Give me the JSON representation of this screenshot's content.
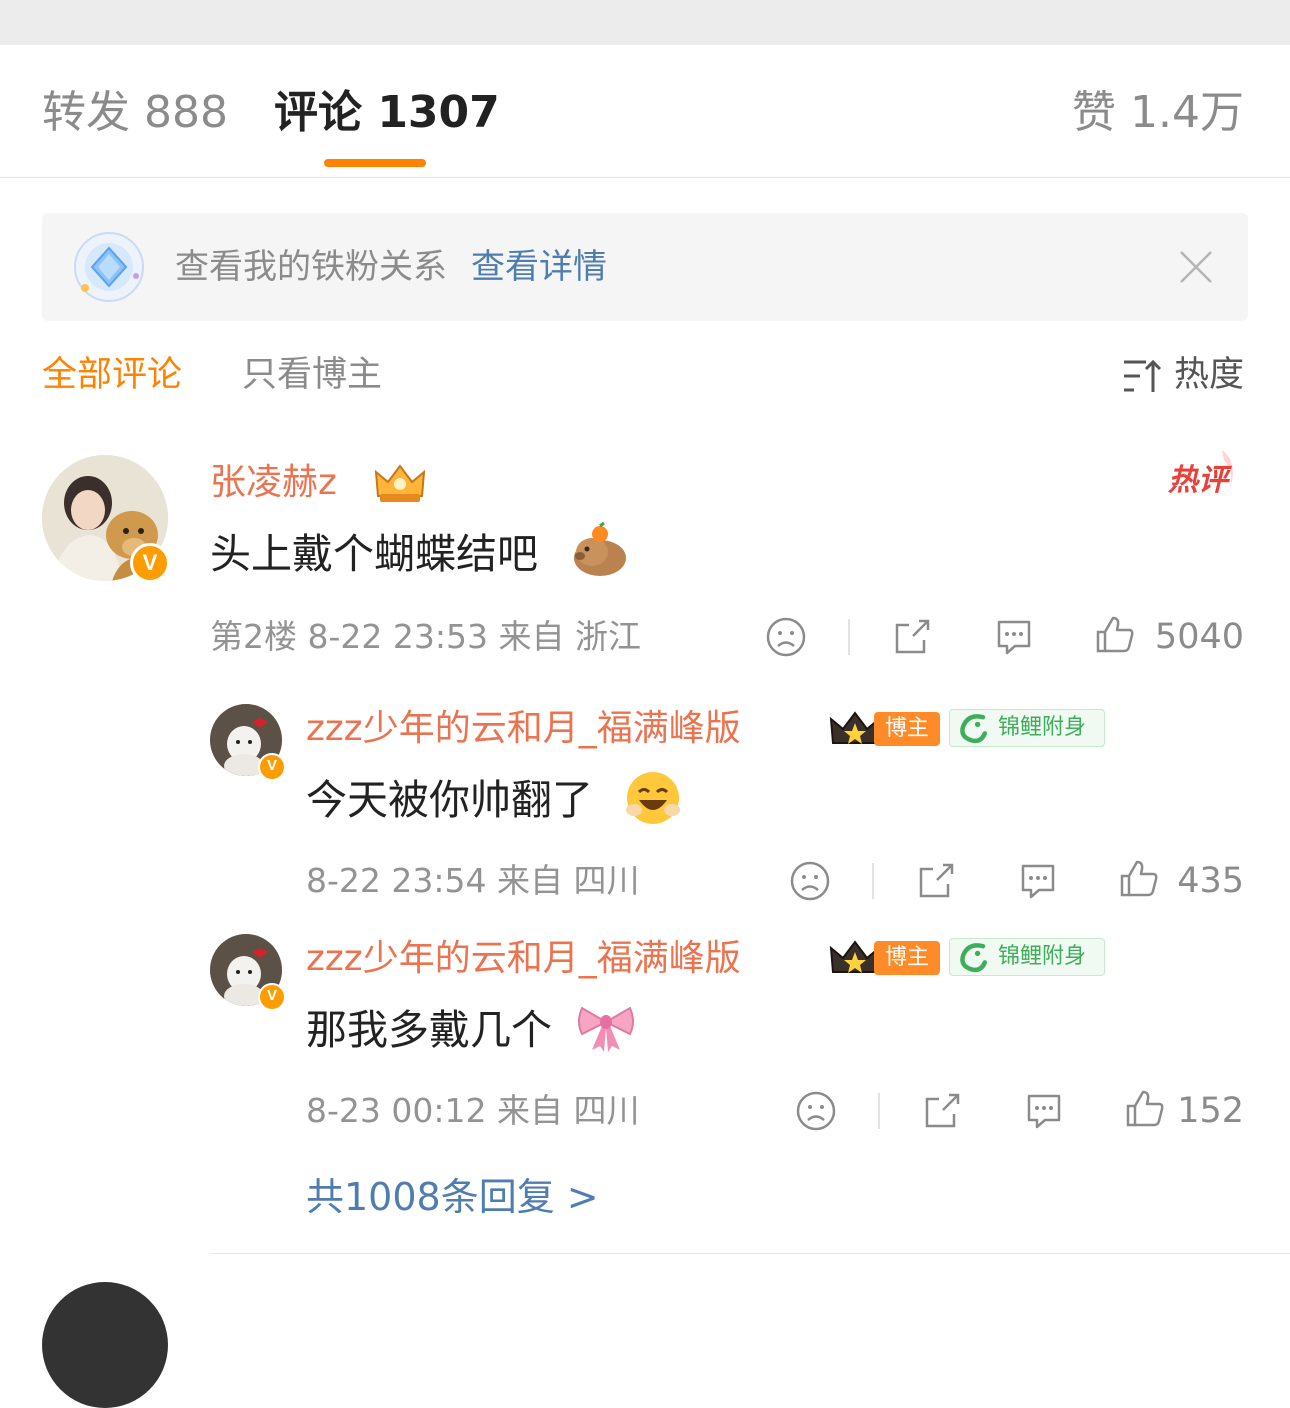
{
  "tabs": {
    "repost": "转发 888",
    "comments": "评论 1307",
    "likes": "赞 1.4万"
  },
  "fan_banner": {
    "text": "查看我的铁粉关系",
    "link": "查看详情",
    "icon": "diamond-icon",
    "close_icon": "close-icon"
  },
  "filters": {
    "all": "全部评论",
    "owner_only": "只看博主",
    "sort_label": "热度",
    "sort_icon": "sort-icon"
  },
  "colors": {
    "accent": "#ff8200",
    "username": "#eb7350",
    "link": "#507daf"
  },
  "main_comment": {
    "username": "张凌赫z",
    "text": "头上戴个蝴蝶结吧",
    "emoji": "capybara-emoji",
    "hot_badge": "热评",
    "meta": "第2楼 8-22 23:53 来自 浙江",
    "likes": "5040"
  },
  "replies": [
    {
      "username": "zzz少年的云和月_福满峰版",
      "owner_badge": "博主",
      "koi_badge": "锦鲤附身",
      "text": "今天被你帅翻了",
      "emoji": "smile-emoji",
      "meta": "8-22 23:54 来自 四川",
      "likes": "435"
    },
    {
      "username": "zzz少年的云和月_福满峰版",
      "owner_badge": "博主",
      "koi_badge": "锦鲤附身",
      "text": "那我多戴几个",
      "emoji": "bow-emoji",
      "meta": "8-23 00:12 来自 四川",
      "likes": "152"
    }
  ],
  "more_replies": "共1008条回复 >"
}
